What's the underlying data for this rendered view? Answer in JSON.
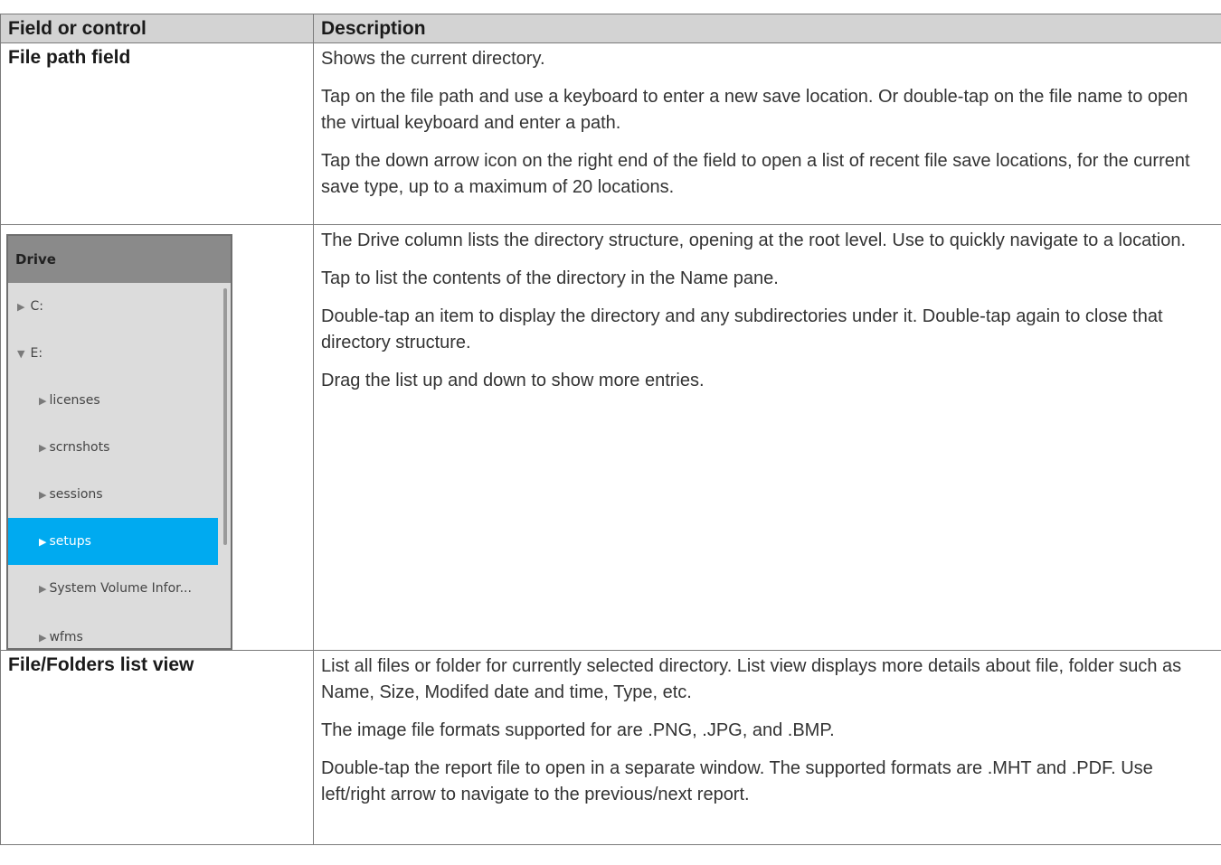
{
  "table": {
    "headers": [
      "Field or control",
      "Description"
    ],
    "rows": [
      {
        "field": "File path field",
        "desc": [
          "Shows the current directory.",
          "Tap on the file path and use a keyboard to enter a new save location. Or double-tap on the file name to open the virtual keyboard and enter a path.",
          "Tap the down arrow icon on the right end of the field to open a list of recent file save locations, for the current save type, up to a maximum of 20 locations."
        ]
      },
      {
        "field": "",
        "desc": [
          "The Drive column lists the directory structure, opening at the root level. Use to quickly navigate to a location.",
          "Tap to list the contents of the directory in the Name pane.",
          "Double-tap an item to display the directory and any subdirectories under it. Double-tap again to close that directory structure.",
          "Drag the list up and down to show more entries."
        ]
      },
      {
        "field": "File/Folders list view",
        "desc": [
          "List all files or folder for currently selected directory. List view displays more details about file, folder such as Name, Size, Modifed date and time, Type, etc.",
          "The image file formats supported for are .PNG, .JPG, and .BMP.",
          "Double-tap the report file to open in a separate window. The supported formats are .MHT and .PDF. Use left/right arrow to navigate to the previous/next report."
        ]
      }
    ]
  },
  "drive_panel": {
    "header": "Drive",
    "items": [
      {
        "label": "C:",
        "icon": "triangle-right-icon",
        "indent": 0
      },
      {
        "label": "E:",
        "icon": "triangle-down-icon",
        "indent": 0
      },
      {
        "label": "licenses",
        "icon": "triangle-right-icon",
        "indent": 1
      },
      {
        "label": "scrnshots",
        "icon": "triangle-right-icon",
        "indent": 1
      },
      {
        "label": "sessions",
        "icon": "triangle-right-icon",
        "indent": 1
      },
      {
        "label": "setups",
        "icon": "triangle-right-icon",
        "indent": 1,
        "selected": true
      },
      {
        "label": "System Volume Infor...",
        "icon": "triangle-right-icon",
        "indent": 1
      },
      {
        "label": "wfms",
        "icon": "triangle-right-icon",
        "indent": 1
      }
    ],
    "colors": {
      "selected": "#00aaf0",
      "header": "#8a8a8a",
      "background": "#dcdcdc"
    }
  }
}
